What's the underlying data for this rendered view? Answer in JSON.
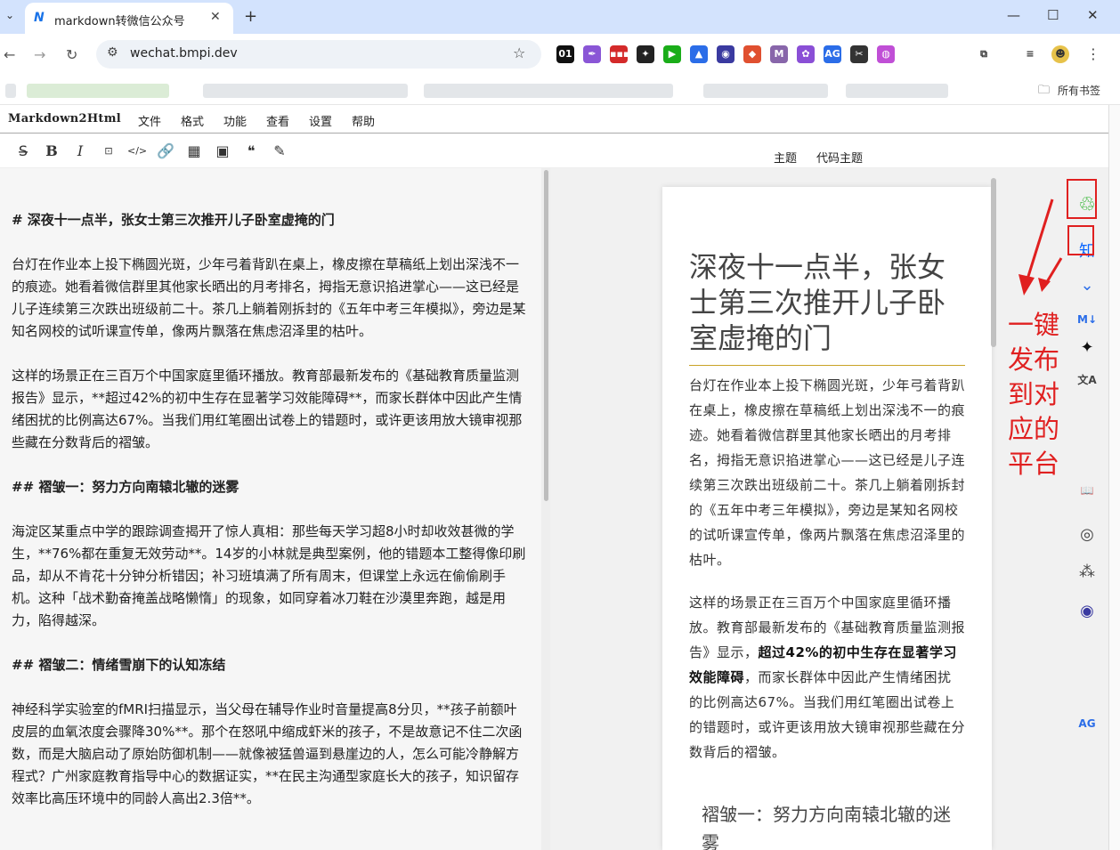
{
  "browser": {
    "tab_title": "markdown转微信公众号",
    "tab_favicon": "N",
    "url": "wechat.bmpi.dev",
    "bookmarks_label": "所有书签",
    "extensions": [
      "01",
      "✒",
      "▪▪▪",
      "✦",
      "▶",
      "▲",
      "◉",
      "◆",
      "M",
      "✿",
      "AG",
      "✂",
      "◍"
    ]
  },
  "app": {
    "brand": "Markdown2Html",
    "menu": [
      "文件",
      "格式",
      "功能",
      "查看",
      "设置",
      "帮助"
    ],
    "format_tools": [
      "strikethrough-icon",
      "bold-icon",
      "italic-icon",
      "terminal-icon",
      "code-icon",
      "link-icon",
      "table-icon",
      "image-icon",
      "quote-icon",
      "magic-wand-icon"
    ],
    "format_glyphs": [
      "S̶",
      "B",
      "I",
      "⊡",
      "</>",
      "🔗",
      "▦",
      "▣",
      "❝",
      "✎"
    ],
    "theme_label": "主题",
    "code_theme_label": "代码主题"
  },
  "editor": {
    "paragraphs": [
      {
        "text": "# 深夜十一点半，张女士第三次推开儿子卧室虚掩的门",
        "heading": true
      },
      {
        "text": "台灯在作业本上投下椭圆光斑，少年弓着背趴在桌上，橡皮擦在草稿纸上划出深浅不一的痕迹。她看着微信群里其他家长晒出的月考排名，拇指无意识掐进掌心——这已经是儿子连续第三次跌出班级前二十。茶几上躺着刚拆封的《五年中考三年模拟》，旁边是某知名网校的试听课宣传单，像两片飘落在焦虑沼泽里的枯叶。",
        "heading": false
      },
      {
        "text": "这样的场景正在三百万个中国家庭里循环播放。教育部最新发布的《基础教育质量监测报告》显示，**超过42%的初中生存在显著学习效能障碍**，而家长群体中因此产生情绪困扰的比例高达67%。当我们用红笔圈出试卷上的错题时，或许更该用放大镜审视那些藏在分数背后的褶皱。",
        "heading": false
      },
      {
        "text": "## 褶皱一：努力方向南辕北辙的迷雾",
        "heading": true
      },
      {
        "text": "海淀区某重点中学的跟踪调查揭开了惊人真相：那些每天学习超8小时却收效甚微的学生，**76%都在重复无效劳动**。14岁的小林就是典型案例，他的错题本工整得像印刷品，却从不肯花十分钟分析错因；补习班填满了所有周末，但课堂上永远在偷偷刷手机。这种「战术勤奋掩盖战略懒惰」的现象，如同穿着冰刀鞋在沙漠里奔跑，越是用力，陷得越深。",
        "heading": false
      },
      {
        "text": "## 褶皱二：情绪雪崩下的认知冻结",
        "heading": true
      },
      {
        "text": "神经科学实验室的fMRI扫描显示，当父母在辅导作业时音量提高8分贝，**孩子前额叶皮层的血氧浓度会骤降30%**。那个在怒吼中缩成虾米的孩子，不是故意记不住二次函数，而是大脑启动了原始防御机制——就像被猛兽逼到悬崖边的人，怎么可能冷静解方程式？广州家庭教育指导中心的数据证实，**在民主沟通型家庭长大的孩子，知识留存效率比高压环境中的同龄人高出2.3倍**。",
        "heading": false
      }
    ]
  },
  "preview": {
    "title": "深夜十一点半，张女士第三次推开儿子卧室虚掩的门",
    "para1": "台灯在作业本上投下椭圆光斑，少年弓着背趴在桌上，橡皮擦在草稿纸上划出深浅不一的痕迹。她看着微信群里其他家长晒出的月考排名，拇指无意识掐进掌心——这已经是儿子连续第三次跌出班级前二十。茶几上躺着刚拆封的《五年中考三年模拟》，旁边是某知名网校的试听课宣传单，像两片飘落在焦虑沼泽里的枯叶。",
    "para2_a": "这样的场景正在三百万个中国家庭里循环播放。教育部最新发布的《基础教育质量监测报告》显示，",
    "para2_bold": "超过42%的初中生存在显著学习效能障碍",
    "para2_b": "，而家长群体中因此产生情绪困扰的比例高达67%。当我们用红笔圈出试卷上的错题时，或许更该用放大镜审视那些藏在分数背后的褶皱。",
    "h2": "褶皱一：努力方向南辕北辙的迷雾"
  },
  "sidebar": {
    "icons": [
      {
        "name": "publish-platform-1-icon",
        "glyph": "♲",
        "color": "#1aad19"
      },
      {
        "name": "zhihu-icon",
        "glyph": "知",
        "color": "#0a66ff"
      },
      {
        "name": "collapse-icon",
        "glyph": "⌄",
        "color": "#2b6de8"
      },
      {
        "name": "markdown-icon",
        "glyph": "M↓",
        "color": "#2b6de8"
      },
      {
        "name": "sparkle-icon",
        "glyph": "✦",
        "color": "#111"
      },
      {
        "name": "translate-icon",
        "glyph": "文A",
        "color": "#444"
      },
      {
        "name": "book-icon",
        "glyph": "📖",
        "color": "#444"
      },
      {
        "name": "podcast-icon",
        "glyph": "◎",
        "color": "#444"
      },
      {
        "name": "apps-icon",
        "glyph": "⁂",
        "color": "#444"
      },
      {
        "name": "assistant-icon",
        "glyph": "◉",
        "color": "#3a3aa0"
      },
      {
        "name": "ag-icon",
        "glyph": "AG",
        "color": "#2b6de8"
      }
    ],
    "annotation": "一键发布到对应的平台"
  }
}
